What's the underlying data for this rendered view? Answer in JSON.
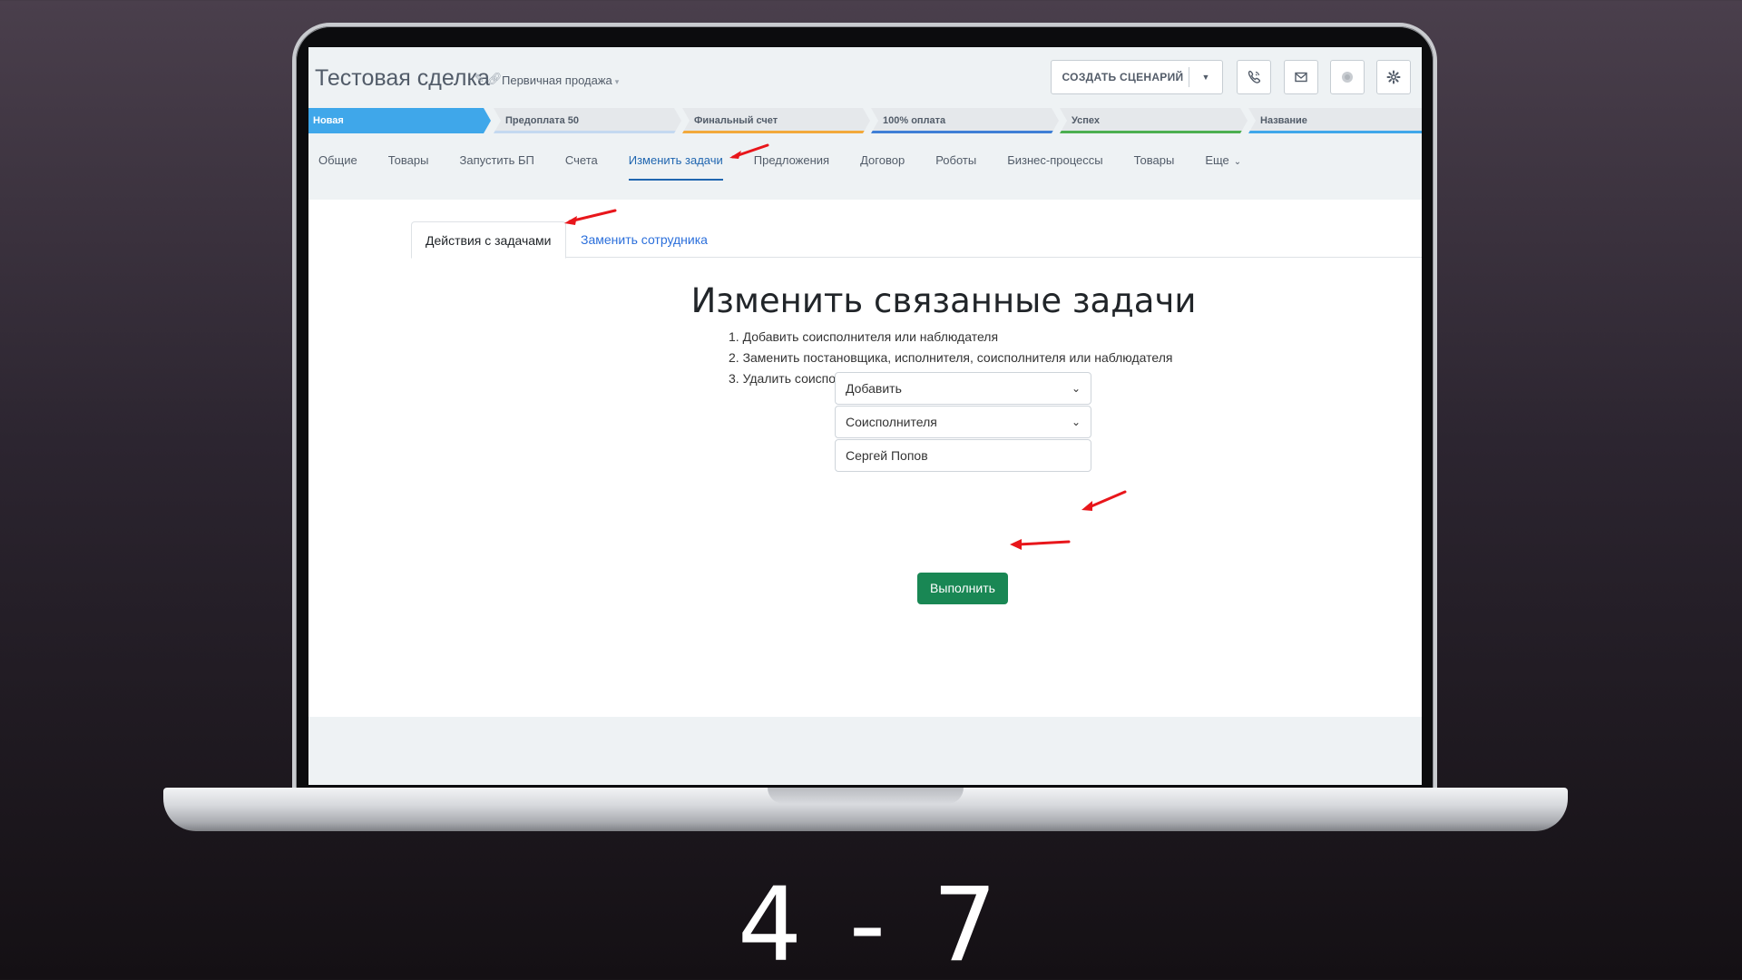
{
  "deal": {
    "title": "Тестовая сделка",
    "funnel": "Первичная продажа"
  },
  "toolbar": {
    "scenario_label": "СОЗДАТЬ СЦЕНАРИЙ",
    "icons": [
      "phone-icon",
      "mail-icon",
      "status-dot-icon",
      "gear-icon"
    ]
  },
  "stages": [
    {
      "label": "Новая",
      "color": "#3fa7ea"
    },
    {
      "label": "Предоплата 50",
      "color": "#c4d9f0"
    },
    {
      "label": "Финальный счет",
      "color": "#f2a93b"
    },
    {
      "label": "100% оплата",
      "color": "#3f7fd6"
    },
    {
      "label": "Успех",
      "color": "#4caf50"
    },
    {
      "label": "Название",
      "color": "#3fa7ea"
    }
  ],
  "tabs": [
    {
      "label": "Общие"
    },
    {
      "label": "Товары"
    },
    {
      "label": "Запустить БП"
    },
    {
      "label": "Счета"
    },
    {
      "label": "Изменить задачи"
    },
    {
      "label": "Предложения"
    },
    {
      "label": "Договор"
    },
    {
      "label": "Роботы"
    },
    {
      "label": "Бизнес-процессы"
    },
    {
      "label": "Товары"
    },
    {
      "label": "Еще"
    }
  ],
  "subtabs": {
    "actions": "Действия с задачами",
    "replace": "Заменить сотрудника"
  },
  "form": {
    "heading": "Изменить связанные задачи",
    "steps": [
      "1. Добавить соисполнителя или наблюдателя",
      "2. Заменить постановщика, исполнителя, соисполнителя или наблюдателя",
      "3. Удалить соисполнителя или наблюдателя"
    ],
    "action_value": "Добавить",
    "role_value": "Соисполнителя",
    "employee_value": "Сергей Попов",
    "submit_label": "Выполнить"
  },
  "slide": {
    "counter": "4 - 7"
  },
  "colors": {
    "accent": "#2066b0",
    "submit": "#198754",
    "annotation_arrow": "#e8161b"
  }
}
